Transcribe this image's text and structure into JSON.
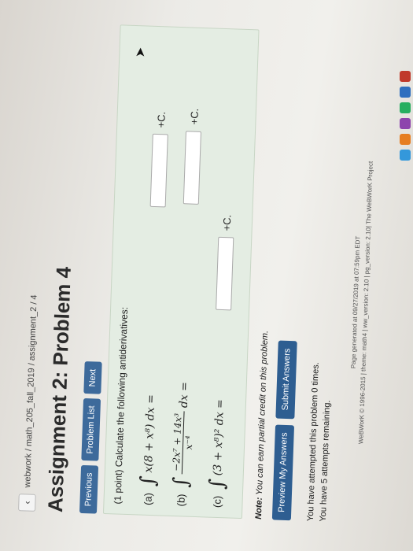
{
  "breadcrumb": "webwork / math_205_fall_2019 / assignment_2 / 4",
  "back_icon": "chevron-left-icon",
  "page_title": "Assignment 2: Problem 4",
  "nav": {
    "previous": "Previous",
    "problem_list": "Problem List",
    "next": "Next"
  },
  "problem": {
    "intro": "(1 point) Calculate the following antiderivatives:",
    "parts": [
      {
        "label": "(a)",
        "expr": "x(8 + x⁸) dx =",
        "answer": "",
        "suffix": "+C."
      },
      {
        "label": "(b)",
        "num": "−2x⁷ + 14x³",
        "den": "x⁻⁴",
        "tail": "dx =",
        "answer": "",
        "suffix": "+C."
      },
      {
        "label": "(c)",
        "expr": "(3 + x⁸)² dx =",
        "answer": "",
        "suffix": "+C."
      }
    ]
  },
  "note_prefix": "Note:",
  "note_text": " You can earn partial credit on this problem.",
  "actions": {
    "preview": "Preview My Answers",
    "submit": "Submit Answers"
  },
  "attempts": [
    "You have attempted this problem 0 times.",
    "You have 5 attempts remaining."
  ],
  "footer": [
    "Page generated at 09/27/2019 at 07:59pm EDT",
    "WeBWorK © 1996-2015 | theme: math4 | ww_version: 2.10 | pg_version: 2.10| The WeBWorK Project"
  ],
  "colors": {
    "nav_button": "#3d6a9b",
    "problem_bg": "#e4ede3",
    "action_button": "#2e5e91"
  }
}
